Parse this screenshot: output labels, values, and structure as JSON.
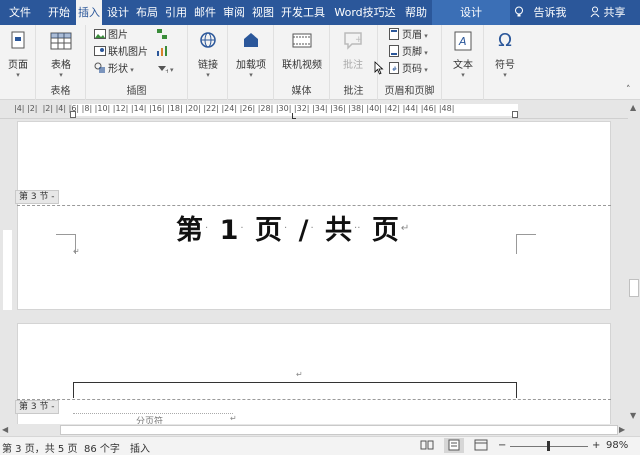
{
  "tabs": [
    {
      "label": "文件"
    },
    {
      "label": "开始"
    },
    {
      "label": "插入"
    },
    {
      "label": "设计"
    },
    {
      "label": "布局"
    },
    {
      "label": "引用"
    },
    {
      "label": "邮件"
    },
    {
      "label": "审阅"
    },
    {
      "label": "视图"
    },
    {
      "label": "开发工具"
    },
    {
      "label": "Word技巧达人"
    },
    {
      "label": "帮助"
    },
    {
      "label": "设计"
    }
  ],
  "tellme": "告诉我",
  "share": "共享",
  "ribbon": {
    "page": "页面",
    "table": "表格",
    "table_group": "表格",
    "picture": "图片",
    "online_picture": "联机图片",
    "shapes": "形状",
    "illustrations_group": "插图",
    "link": "链接",
    "addins": "加载项",
    "online_video": "联机视频",
    "media_group": "媒体",
    "comment": "批注",
    "comment_group": "批注",
    "header": "页眉",
    "footer": "页脚",
    "page_number": "页码",
    "header_footer_group": "页眉和页脚",
    "text": "文本",
    "symbol": "符号",
    "symbol_icon": "Ω"
  },
  "ruler": {
    "numbers": "|4| |2|  |2| |4| |6| |8| |10| |12| |14| |16| |18| |20| |22| |24| |26| |28| |30| |32| |34| |36| |38| |40| |42| |44| |46| |48|"
  },
  "document": {
    "section_tag_1": "第 3 节 -",
    "section_tag_2": "第 3 节 -",
    "page_field": {
      "part1": "第",
      "num": "1",
      "part2": "页",
      "slash": "/",
      "part3": "共",
      "part4": "页"
    },
    "page_break": "分页符"
  },
  "status": {
    "page_info": "第 3 页，共 5 页",
    "word_count": "86 个字",
    "mode": "插入",
    "zoom": "98%",
    "zoom_minus": "−",
    "zoom_plus": "+"
  },
  "colors": {
    "accent": "#2b579a"
  }
}
